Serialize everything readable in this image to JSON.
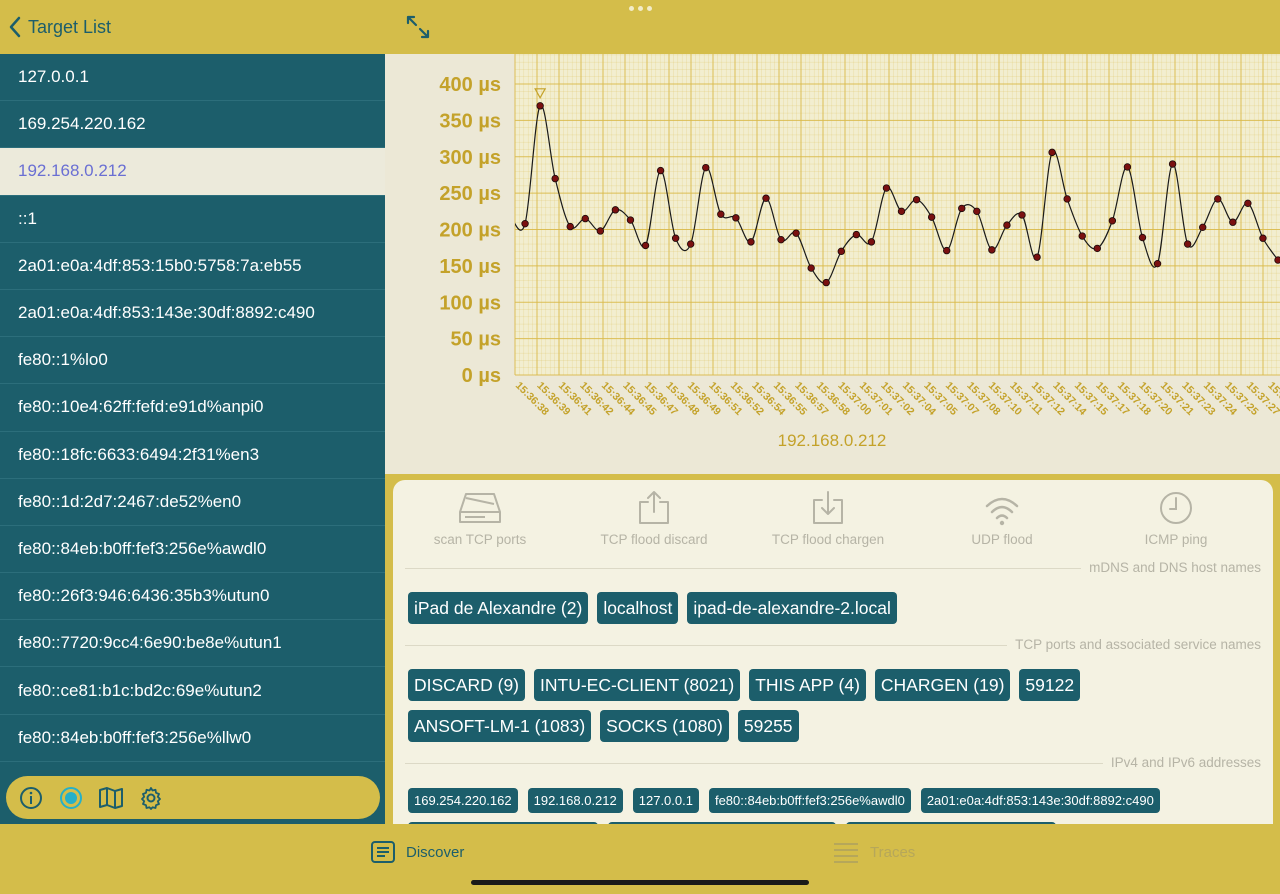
{
  "header": {
    "back_label": "Target List"
  },
  "targets": [
    {
      "label": "127.0.0.1",
      "selected": false
    },
    {
      "label": "169.254.220.162",
      "selected": false
    },
    {
      "label": "192.168.0.212",
      "selected": true
    },
    {
      "label": "::1",
      "selected": false
    },
    {
      "label": "2a01:e0a:4df:853:15b0:5758:7a:eb55",
      "selected": false
    },
    {
      "label": "2a01:e0a:4df:853:143e:30df:8892:c490",
      "selected": false
    },
    {
      "label": "fe80::1%lo0",
      "selected": false
    },
    {
      "label": "fe80::10e4:62ff:fefd:e91d%anpi0",
      "selected": false
    },
    {
      "label": "fe80::18fc:6633:6494:2f31%en3",
      "selected": false
    },
    {
      "label": "fe80::1d:2d7:2467:de52%en0",
      "selected": false
    },
    {
      "label": "fe80::84eb:b0ff:fef3:256e%awdl0",
      "selected": false
    },
    {
      "label": "fe80::26f3:946:6436:35b3%utun0",
      "selected": false
    },
    {
      "label": "fe80::7720:9cc4:6e90:be8e%utun1",
      "selected": false
    },
    {
      "label": "fe80::ce81:b1c:bd2c:69e%utun2",
      "selected": false
    },
    {
      "label": "fe80::84eb:b0ff:fef3:256e%llw0",
      "selected": false
    }
  ],
  "sidebar_toolbar": {
    "icons": [
      "info-icon",
      "record-icon",
      "map-icon",
      "gear-icon"
    ]
  },
  "chart_data": {
    "type": "line",
    "title": "",
    "xlabel": "192.168.0.212",
    "ylabel": "",
    "y_unit": "µs",
    "ylim": [
      0,
      400
    ],
    "y_ticks": [
      "0 µs",
      "50 µs",
      "100 µs",
      "150 µs",
      "200 µs",
      "250 µs",
      "300 µs",
      "350 µs",
      "400 µs"
    ],
    "x_tick_labels": [
      "15:36:38",
      "15:36:39",
      "15:36:41",
      "15:36:42",
      "15:36:44",
      "15:36:45",
      "15:36:47",
      "15:36:48",
      "15:36:49",
      "15:36:51",
      "15:36:52",
      "15:36:54",
      "15:36:55",
      "15:36:57",
      "15:36:58",
      "15:37:00",
      "15:37:01",
      "15:37:02",
      "15:37:04",
      "15:37:05",
      "15:37:07",
      "15:37:08",
      "15:37:10",
      "15:37:11",
      "15:37:12",
      "15:37:14",
      "15:37:15",
      "15:37:17",
      "15:37:18",
      "15:37:20",
      "15:37:21",
      "15:37:23",
      "15:37:24",
      "15:37:25",
      "15:37:27",
      "15:37:2"
    ],
    "series": [
      {
        "values": [
          220,
          208,
          370,
          270,
          204,
          215,
          198,
          227,
          213,
          178,
          281,
          188,
          180,
          285,
          221,
          216,
          183,
          243,
          186,
          195,
          147,
          127,
          170,
          193,
          183,
          257,
          225,
          241,
          217,
          171,
          229,
          225,
          172,
          206,
          220,
          162,
          306,
          242,
          191,
          174,
          212,
          286,
          189,
          153,
          290,
          180,
          203,
          242,
          210,
          236,
          188,
          158
        ],
        "color": "#1a1a1a",
        "marker_color": "#7a1010"
      }
    ],
    "max_marker_index": 2,
    "grid": true,
    "grid_color": "#d9b94a"
  },
  "actions": [
    {
      "label": "scan TCP ports",
      "icon": "scanner-icon"
    },
    {
      "label": "TCP flood discard",
      "icon": "share-upload-icon"
    },
    {
      "label": "TCP flood chargen",
      "icon": "download-tray-icon"
    },
    {
      "label": "UDP flood",
      "icon": "wifi-icon"
    },
    {
      "label": "ICMP ping",
      "icon": "clock-icon"
    }
  ],
  "sections": {
    "dns_title": "mDNS and DNS host names",
    "tcp_title": "TCP ports and associated service names",
    "ip_title": "IPv4 and IPv6 addresses"
  },
  "dns_names": [
    "iPad de Alexandre (2)",
    "localhost",
    "ipad-de-alexandre-2.local"
  ],
  "tcp_ports_row1": [
    "DISCARD (9)",
    "INTU-EC-CLIENT (8021)",
    "THIS APP (4)",
    "CHARGEN (19)",
    "59122"
  ],
  "tcp_ports_row2": [
    "ANSOFT-LM-1 (1083)",
    "SOCKS (1080)",
    "59255"
  ],
  "ip_addresses": [
    "169.254.220.162",
    "192.168.0.212",
    "127.0.0.1",
    "fe80::84eb:b0ff:fef3:256e%awdl0",
    "2a01:e0a:4df:853:143e:30df:8892:c490"
  ],
  "tabs": [
    {
      "label": "Discover",
      "active": true,
      "icon": "discover-icon"
    },
    {
      "label": "Traces",
      "active": false,
      "icon": "list-icon"
    }
  ]
}
